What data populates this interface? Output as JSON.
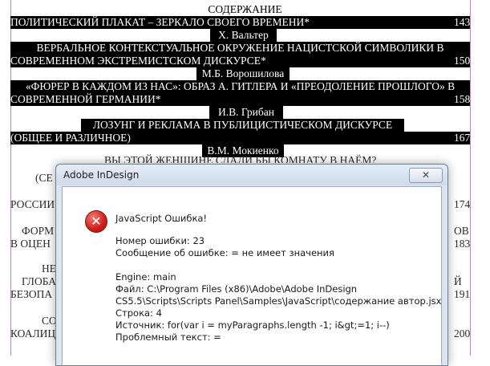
{
  "document": {
    "heading": "СОДЕРЖАНИЕ",
    "entries": [
      {
        "title": "ПОЛИТИЧЕСКИЙ ПЛАКАТ – ЗЕРКАЛО СВОЕГО ВРЕМЕНИ*",
        "page": "143"
      },
      {
        "author": "Х. Вальтер"
      },
      {
        "title_line1": "ВЕРБАЛЬНОЕ КОНТЕКСТУАЛЬНОЕ ОКРУЖЕНИЕ НАЦИСТСКОЙ СИМВОЛИКИ В",
        "title_line2": "СОВРЕМЕННОМ ЭКСТРЕМИСТСКОМ ДИСКУРСЕ*",
        "page": "150"
      },
      {
        "author": "М.Б. Ворошилова"
      },
      {
        "title_line1": "«ФЮРЕР В КАЖДОМ ИЗ НАС»: ОБРАЗ А. ГИТЛЕРА И «ПРЕОДОЛЕНИЕ ПРОШЛОГО» В",
        "title_line2": "СОВРЕМЕННОЙ ГЕРМАНИИ*",
        "page": "158"
      },
      {
        "author": "И.В. Грибан"
      },
      {
        "title_line1": "ЛОЗУНГ И РЕКЛАМА В ПУБЛИЦИСТИЧЕСКОМ ДИСКУРСЕ",
        "title_line2": "(ОБЩЕЕ И РАЗЛИЧНОЕ)",
        "page": "167"
      },
      {
        "author": "В.М. Мокиенко"
      },
      {
        "title_line1": "ВЫ ЭТОЙ ЖЕНЩИНЕ СДАЛИ БЫ КОМНАТУ В НАЁМ?"
      }
    ],
    "partial_left": [
      "(СЕ",
      "РОССИИ",
      "ФОРМ",
      "В ОЦЕН",
      "НЕ",
      "ГЛОБА",
      "БЕЗОПА",
      "СО",
      "КОАЛИЦ"
    ],
    "partial_right": [
      "174",
      "ОВ",
      "183",
      "Й",
      "191",
      "200"
    ]
  },
  "dialog": {
    "title": "Adobe InDesign",
    "close_glyph": "✕",
    "icon": "error-icon",
    "error_glyph": "✕",
    "heading": "JavaScript Ошибка!",
    "lines": [
      "Номер ошибки: 23",
      "Сообщение об ошибке: = не имеет значения",
      "",
      "Engine: main",
      "Файл: C:\\Program Files (x86)\\Adobe\\Adobe InDesign",
      "CS5.5\\Scripts\\Scripts Panel\\Samples\\JavaScript\\содержание автор.jsx",
      "Строка: 4",
      "Источник: for(var i = myParagraphs.length -1; i&gt;=1; i--)",
      "Проблемный текст: ="
    ]
  },
  "colors": {
    "highlight": "#000000",
    "guide": "#c77fd6",
    "dialog_frame": "#dbe5f1",
    "error_red": "#cc1f1a"
  }
}
